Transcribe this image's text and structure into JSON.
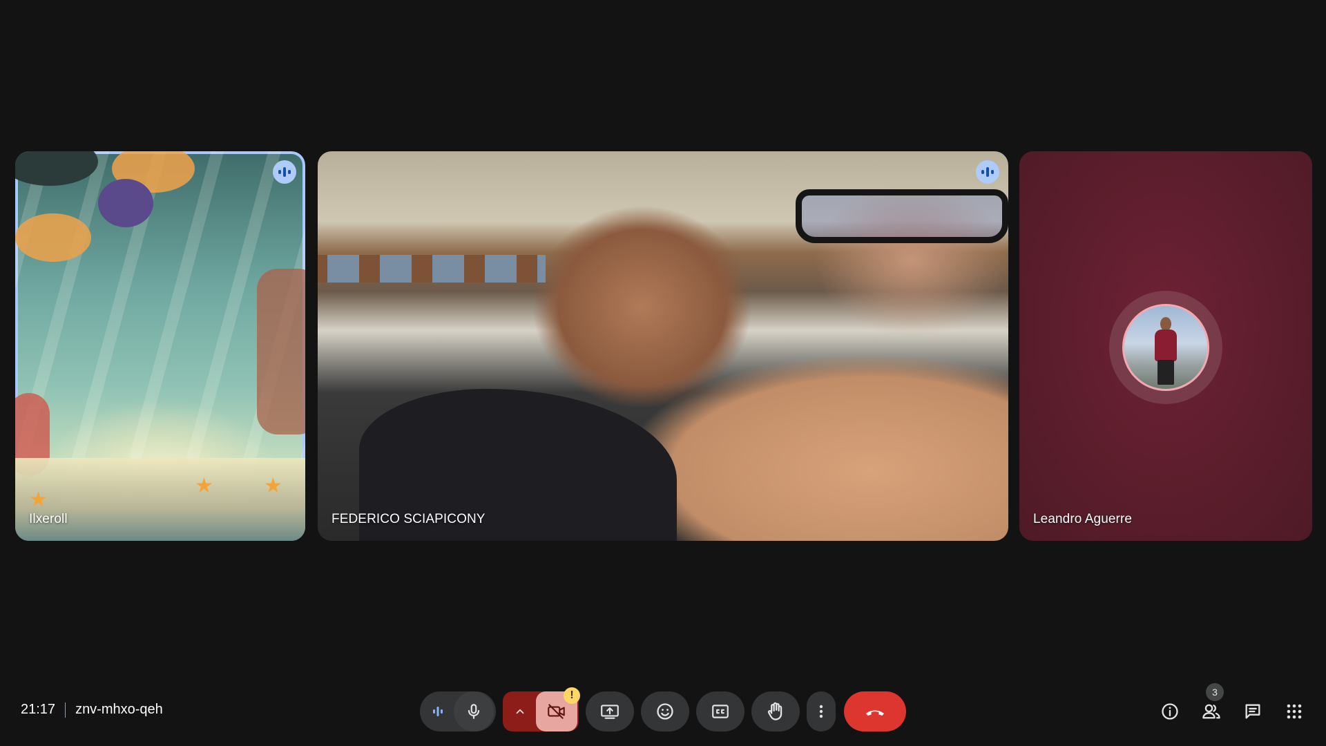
{
  "meeting": {
    "time": "21:17",
    "code": "znv-mhxo-qeh"
  },
  "participants": [
    {
      "name": "Ilxeroll",
      "speaking": true,
      "video": "background-underwater"
    },
    {
      "name": "FEDERICO SCIAPICONY",
      "speaking": true,
      "video": "camera"
    },
    {
      "name": "Leandro Aguerre",
      "speaking": false,
      "video": "off-avatar"
    }
  ],
  "controls": {
    "icons": [
      "audio-level-icon",
      "mic-icon",
      "chevron-up-icon",
      "camera-off-icon",
      "present-screen-icon",
      "emoji-icon",
      "captions-icon",
      "raise-hand-icon",
      "more-vert-icon",
      "end-call-icon"
    ],
    "camera_warning": "!"
  },
  "right_panel": {
    "people_count": "3",
    "icons": [
      "info-icon",
      "people-icon",
      "chat-icon",
      "apps-grid-icon"
    ]
  },
  "colors": {
    "background": "#131313",
    "active_speaker_border": "#a8c7fa",
    "end_call": "#dc362e",
    "camera_off": "#8c1d18",
    "warning": "#fdd663"
  }
}
